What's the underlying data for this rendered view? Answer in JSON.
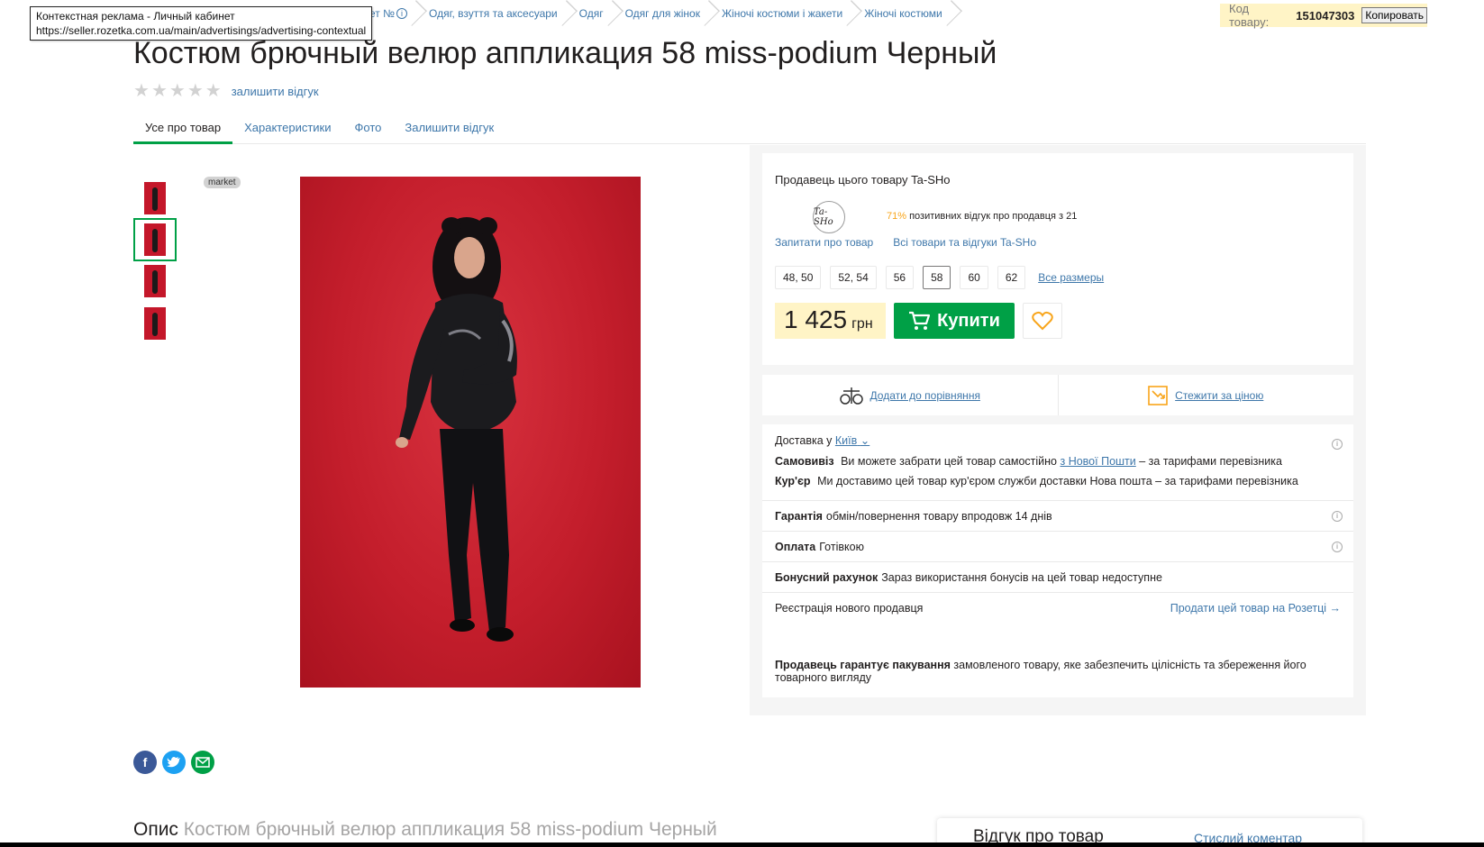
{
  "tooltip": {
    "title": "Контекстная реклама - Личный кабинет",
    "url": "https://seller.rozetka.com.ua/main/advertisings/advertising-contextual"
  },
  "breadcrumbs": [
    {
      "label": "жет №"
    },
    {
      "label": "Одяг, взуття та аксесуари"
    },
    {
      "label": "Одяг"
    },
    {
      "label": "Одяг для жінок"
    },
    {
      "label": "Жіночі костюми і жакети"
    },
    {
      "label": "Жіночі костюми"
    }
  ],
  "product_code": {
    "label": "Код товару:",
    "value": "151047303",
    "copy_label": "Копировать"
  },
  "title": "Костюм брючный велюр аппликация 58 miss-podium Черный",
  "rating": {
    "stars": 0,
    "max": 5,
    "review_link": "залишити відгук"
  },
  "tabs": [
    {
      "label": "Усе про товар",
      "active": true
    },
    {
      "label": "Характеристики",
      "active": false
    },
    {
      "label": "Фото",
      "active": false
    },
    {
      "label": "Залишити відгук",
      "active": false
    }
  ],
  "gallery": {
    "badge": "market",
    "thumbnail_count": 4,
    "selected_index": 1
  },
  "seller": {
    "label": "Продавець цього товару",
    "name": "Ta-SHo",
    "logo_text": "Ta-SHo",
    "positive_pct": "71%",
    "positive_text": "позитивних відгук про продавця з 21",
    "ask_link": "Запитати про товар",
    "all_goods_link": "Всі товари та відгуки Ta-SHo"
  },
  "sizes": {
    "options": [
      "48, 50",
      "52, 54",
      "56",
      "58",
      "60",
      "62"
    ],
    "selected": "58",
    "all_link": "Все размеры"
  },
  "price": {
    "value": "1 425",
    "currency": "грн"
  },
  "buy_label": "Купити",
  "compare_label": "Додати до порівняння",
  "watch_price_label": "Стежити за ціною",
  "delivery": {
    "label": "Доставка у",
    "city": "Київ",
    "pickup_title": "Самовивіз",
    "pickup_text": "Ви можете забрати цей товар самостійно",
    "pickup_link": "з Нової Пошти",
    "pickup_suffix": "– за тарифами перевізника",
    "courier_title": "Кур'єр",
    "courier_text": "Ми доставимо цей товар кур'єром служби доставки Нова пошта – за тарифами перевізника"
  },
  "warranty": {
    "title": "Гарантія",
    "text": "обмін/повернення товару впродовж 14 днів"
  },
  "payment": {
    "title": "Оплата",
    "text": "Готівкою"
  },
  "bonus": {
    "title": "Бонусний рахунок",
    "text": "Зараз використання бонусів на цей товар недоступне"
  },
  "registration": {
    "text": "Реєстрація нового продавця",
    "link": "Продати цей товар на Розетці →"
  },
  "packaging": {
    "title": "Продавець гарантує пакування",
    "text": "замовленого товару, яке забезпечить цілісність та збереження його товарного вигляду"
  },
  "share": [
    "facebook-icon",
    "twitter-icon",
    "email-icon"
  ],
  "description": {
    "label": "Опис",
    "product": "Костюм брючный велюр аппликация 58 miss-podium Черный"
  },
  "review_box": {
    "title": "Відгук про товар",
    "link": "Стислий коментар"
  },
  "colors": {
    "green": "#00a046",
    "link": "#3e77aa",
    "yellow": "#fff4c6",
    "orange": "#f8a51b"
  }
}
